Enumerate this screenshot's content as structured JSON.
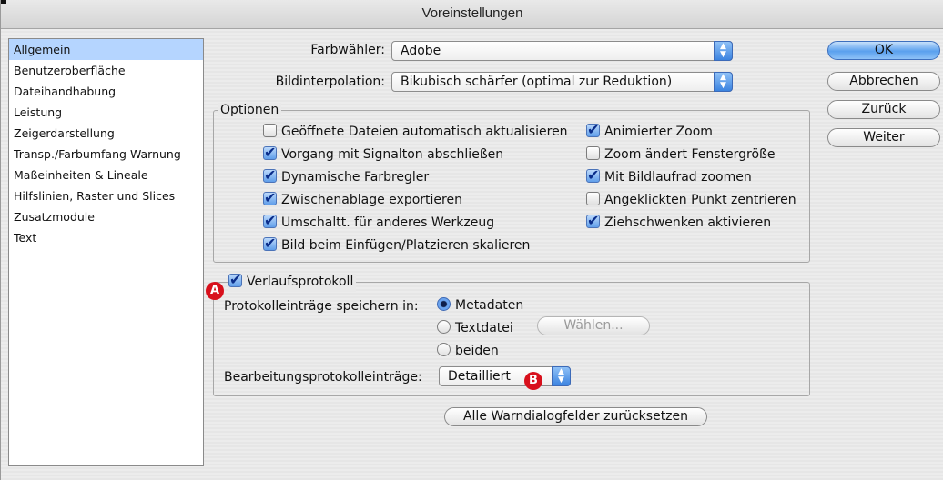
{
  "window": {
    "title": "Voreinstellungen"
  },
  "sidebar": {
    "items": [
      {
        "label": "Allgemein",
        "selected": true
      },
      {
        "label": "Benutzeroberfläche"
      },
      {
        "label": "Dateihandhabung"
      },
      {
        "label": "Leistung"
      },
      {
        "label": "Zeigerdarstellung"
      },
      {
        "label": "Transp./Farbumfang-Warnung"
      },
      {
        "label": "Maßeinheiten & Lineale"
      },
      {
        "label": "Hilfslinien, Raster und Slices"
      },
      {
        "label": "Zusatzmodule"
      },
      {
        "label": "Text"
      }
    ]
  },
  "general": {
    "color_picker_label": "Farbwähler:",
    "color_picker_value": "Adobe",
    "interpolation_label": "Bildinterpolation:",
    "interpolation_value": "Bikubisch schärfer (optimal zur Reduktion)"
  },
  "options": {
    "legend": "Optionen",
    "left": [
      {
        "label": "Geöffnete Dateien automatisch aktualisieren",
        "checked": false
      },
      {
        "label": "Vorgang mit Signalton abschließen",
        "checked": true
      },
      {
        "label": "Dynamische Farbregler",
        "checked": true
      },
      {
        "label": "Zwischenablage exportieren",
        "checked": true
      },
      {
        "label": "Umschaltt. für anderes Werkzeug",
        "checked": true
      },
      {
        "label": "Bild beim Einfügen/Platzieren skalieren",
        "checked": true
      }
    ],
    "right": [
      {
        "label": "Animierter Zoom",
        "checked": true
      },
      {
        "label": "Zoom ändert Fenstergröße",
        "checked": false
      },
      {
        "label": "Mit Bildlaufrad zoomen",
        "checked": true
      },
      {
        "label": "Angeklickten Punkt zentrieren",
        "checked": false
      },
      {
        "label": "Ziehschwenken aktivieren",
        "checked": true
      }
    ]
  },
  "history": {
    "legend": "Verlaufsprotokoll",
    "checked": true,
    "save_label": "Protokolleinträge speichern in:",
    "radios": [
      {
        "label": "Metadaten",
        "selected": true
      },
      {
        "label": "Textdatei",
        "selected": false
      },
      {
        "label": "beiden",
        "selected": false
      }
    ],
    "choose_button": "Wählen...",
    "edit_log_label": "Bearbeitungsprotokolleinträge:",
    "edit_log_value": "Detailliert"
  },
  "buttons": {
    "ok": "OK",
    "cancel": "Abbrechen",
    "back": "Zurück",
    "next": "Weiter",
    "reset_warnings": "Alle Warndialogfelder zurücksetzen"
  },
  "markers": {
    "a": "A",
    "b": "B"
  },
  "icons": {
    "checkmark": "✔",
    "stepper_up": "▲",
    "stepper_down": "▼"
  },
  "colors": {
    "accent": "#5aa0ee",
    "selection": "#b5d5ff",
    "marker": "#d8101c"
  }
}
